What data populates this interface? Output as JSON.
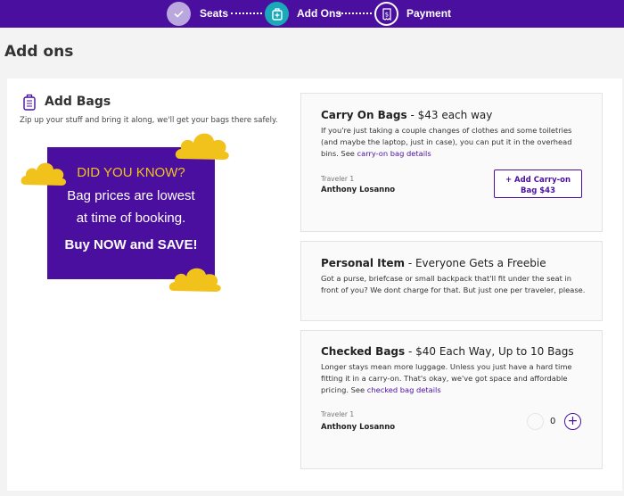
{
  "steps": {
    "seats": "Seats",
    "addons": "Add Ons",
    "payment": "Payment"
  },
  "page_title": "Add ons",
  "add_bags": {
    "title": "Add Bags",
    "subtitle": "Zip up your stuff and bring it along, we'll get your bags there safely."
  },
  "promo": {
    "line1": "DID YOU KNOW?",
    "line2": "Bag prices are lowest",
    "line3": "at time of booking.",
    "line4": "Buy NOW and SAVE!"
  },
  "carry_on": {
    "title": "Carry On Bags",
    "price": " - $43 each way",
    "desc": "If you're just taking a couple changes of clothes and some toiletries (and maybe the laptop, just in case), you can put it in the overhead bins. See ",
    "link": "carry-on bag details",
    "traveler_label": "Traveler 1",
    "traveler_name": "Anthony Losanno",
    "button_line1": "+ Add Carry-on",
    "button_line2": "Bag $43"
  },
  "personal": {
    "title": "Personal Item",
    "subtitle": " - Everyone Gets a Freebie",
    "desc": "Got a purse, briefcase or small backpack that'll fit under the seat in front of you? We dont charge for that. But just one per traveler, please."
  },
  "checked": {
    "title": "Checked Bags",
    "subtitle": " - $40 Each Way, Up to 10 Bags",
    "desc": "Longer stays mean more luggage. Unless you just have a hard time fitting it in a carry-on. That's okay, we've got space and affordable pricing. See ",
    "link": "checked bag details",
    "traveler_label": "Traveler 1",
    "traveler_name": "Anthony Losanno",
    "count": "0"
  },
  "colors": {
    "brand_purple": "#4b0fa0",
    "teal": "#19a9b9",
    "promo_yellow": "#f2c21c"
  }
}
